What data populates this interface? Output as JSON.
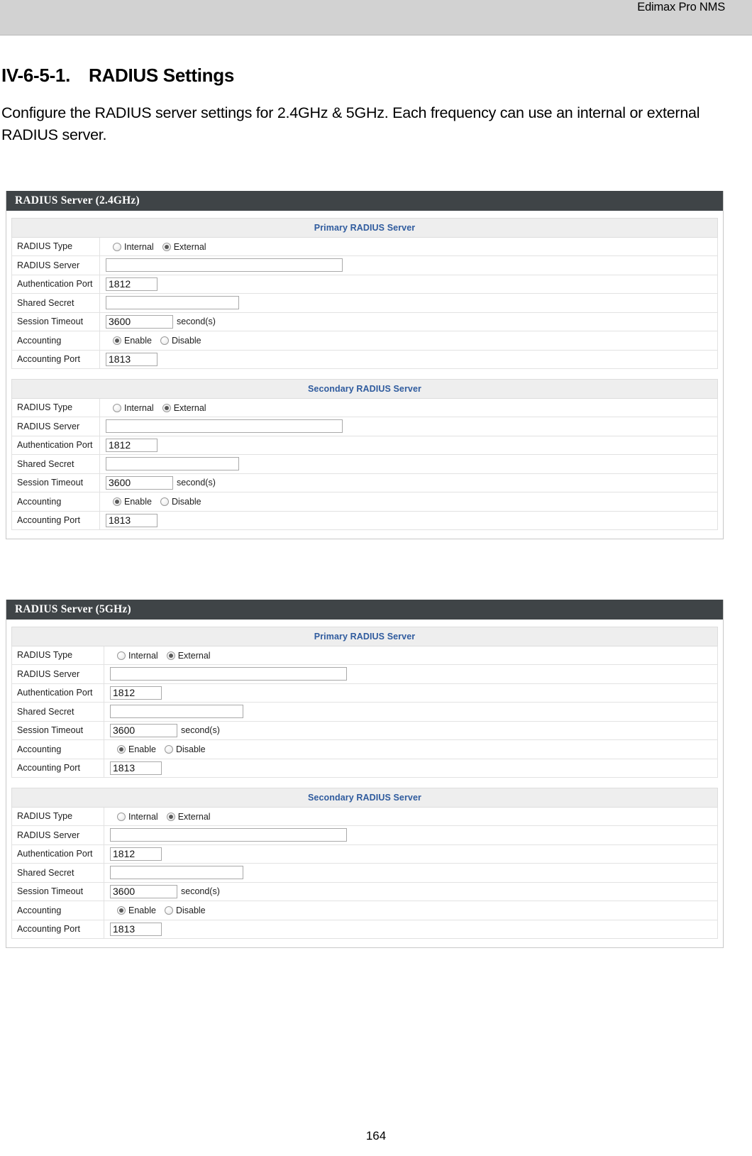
{
  "header": {
    "running_title": "Edimax Pro NMS"
  },
  "document": {
    "heading_number": "IV-6-5-1.",
    "heading_title": "RADIUS Settings",
    "paragraph": "Configure the RADIUS server settings for 2.4GHz & 5GHz. Each frequency can use an internal or external RADIUS server.",
    "page_number": "164"
  },
  "labels": {
    "radius_type": "RADIUS Type",
    "radius_server": "RADIUS Server",
    "authentication_port": "Authentication Port",
    "shared_secret": "Shared Secret",
    "session_timeout": "Session Timeout",
    "accounting": "Accounting",
    "accounting_port": "Accounting Port",
    "seconds_unit": "second(s)",
    "internal": "Internal",
    "external": "External",
    "enable": "Enable",
    "disable": "Disable",
    "primary_group": "Primary RADIUS Server",
    "secondary_group": "Secondary RADIUS Server"
  },
  "colors": {
    "panel_titlebar": "#3f4447",
    "group_header_text": "#2f5b9e",
    "group_header_bg": "#eeeeee",
    "page_header_bg": "#d2d2d2"
  },
  "panels": [
    {
      "title": "RADIUS Server (2.4GHz)",
      "groups": [
        {
          "name": "Primary RADIUS Server",
          "radius_type_selected": "External",
          "radius_server_value": "",
          "authentication_port_value": "1812",
          "shared_secret_value": "",
          "session_timeout_value": "3600",
          "accounting_selected": "Enable",
          "accounting_port_value": "1813"
        },
        {
          "name": "Secondary RADIUS Server",
          "radius_type_selected": "External",
          "radius_server_value": "",
          "authentication_port_value": "1812",
          "shared_secret_value": "",
          "session_timeout_value": "3600",
          "accounting_selected": "Enable",
          "accounting_port_value": "1813"
        }
      ]
    },
    {
      "title": "RADIUS Server (5GHz)",
      "groups": [
        {
          "name": "Primary RADIUS Server",
          "radius_type_selected": "External",
          "radius_server_value": "",
          "authentication_port_value": "1812",
          "shared_secret_value": "",
          "session_timeout_value": "3600",
          "accounting_selected": "Enable",
          "accounting_port_value": "1813"
        },
        {
          "name": "Secondary RADIUS Server",
          "radius_type_selected": "External",
          "radius_server_value": "",
          "authentication_port_value": "1812",
          "shared_secret_value": "",
          "session_timeout_value": "3600",
          "accounting_selected": "Enable",
          "accounting_port_value": "1813"
        }
      ]
    }
  ]
}
